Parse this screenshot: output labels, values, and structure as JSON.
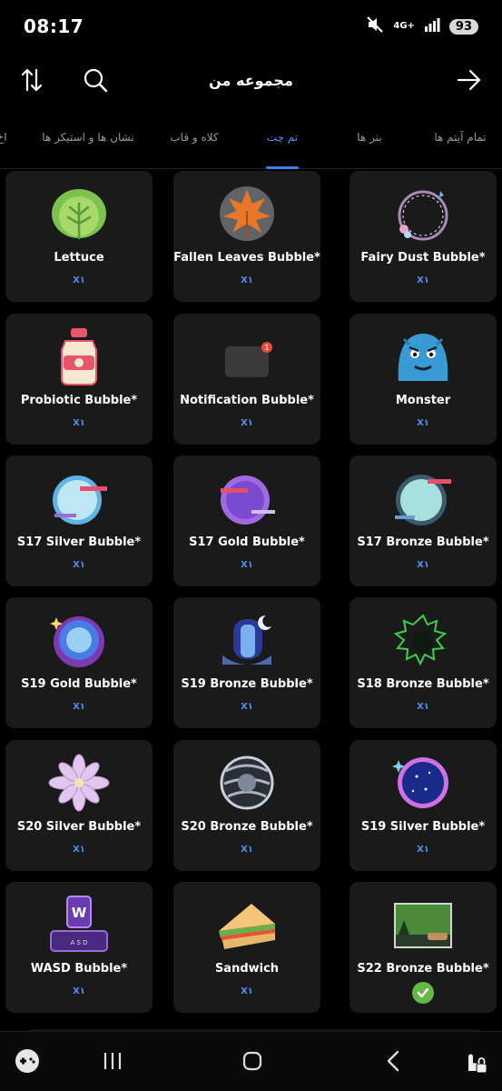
{
  "status_bar": {
    "time": "08:17",
    "network": "4G+",
    "battery": "93"
  },
  "header": {
    "title": "مجموعه من"
  },
  "tabs": [
    {
      "label": "تمام آیتم ها",
      "active": false
    },
    {
      "label": "بنر ها",
      "active": false
    },
    {
      "label": "تم چت",
      "active": true
    },
    {
      "label": "کلاه و قاب",
      "active": false
    },
    {
      "label": "نشان ها و استیکر ها",
      "active": false
    },
    {
      "label": "اخ",
      "active": false
    }
  ],
  "items": [
    {
      "name": "Lettuce",
      "count": "X۱",
      "icon": "lettuce-icon"
    },
    {
      "name": "Fallen Leaves Bubble*",
      "count": "X۱",
      "icon": "fallen-leaves-icon"
    },
    {
      "name": "Fairy Dust Bubble*",
      "count": "X۱",
      "icon": "fairy-dust-icon"
    },
    {
      "name": "Probiotic Bubble*",
      "count": "X۱",
      "icon": "probiotic-icon"
    },
    {
      "name": "Notification Bubble*",
      "count": "X۱",
      "icon": "notification-bubble-icon"
    },
    {
      "name": "Monster",
      "count": "X۱",
      "icon": "monster-icon"
    },
    {
      "name": "S17 Silver Bubble*",
      "count": "X۱",
      "icon": "s17-silver-icon"
    },
    {
      "name": "S17 Gold Bubble*",
      "count": "X۱",
      "icon": "s17-gold-icon"
    },
    {
      "name": "S17 Bronze Bubble*",
      "count": "X۱",
      "icon": "s17-bronze-icon"
    },
    {
      "name": "S19 Gold Bubble*",
      "count": "X۱",
      "icon": "s19-gold-icon"
    },
    {
      "name": "S19 Bronze Bubble*",
      "count": "X۱",
      "icon": "s19-bronze-icon"
    },
    {
      "name": "S18 Bronze Bubble*",
      "count": "X۱",
      "icon": "s18-bronze-icon"
    },
    {
      "name": "S20 Silver Bubble*",
      "count": "X۱",
      "icon": "s20-silver-icon"
    },
    {
      "name": "S20 Bronze Bubble*",
      "count": "X۱",
      "icon": "s20-bronze-icon"
    },
    {
      "name": "S19 Silver Bubble*",
      "count": "X۱",
      "icon": "s19-silver-icon"
    },
    {
      "name": "WASD Bubble*",
      "count": "X۱",
      "icon": "wasd-keys-icon",
      "keycap": "W",
      "keys": "A S D"
    },
    {
      "name": "Sandwich",
      "count": "X۱",
      "icon": "sandwich-icon"
    },
    {
      "name": "S22 Bronze Bubble*",
      "count": "",
      "icon": "s22-bronze-icon",
      "selected": true
    }
  ],
  "nav_bar": {
    "icons": [
      "gamepad-icon",
      "recent-apps-icon",
      "home-icon",
      "back-icon",
      "touch-lock-icon"
    ]
  },
  "colors": {
    "accent": "#3d7ee6",
    "card_bg": "#1a1a1a",
    "check": "#66b845"
  }
}
